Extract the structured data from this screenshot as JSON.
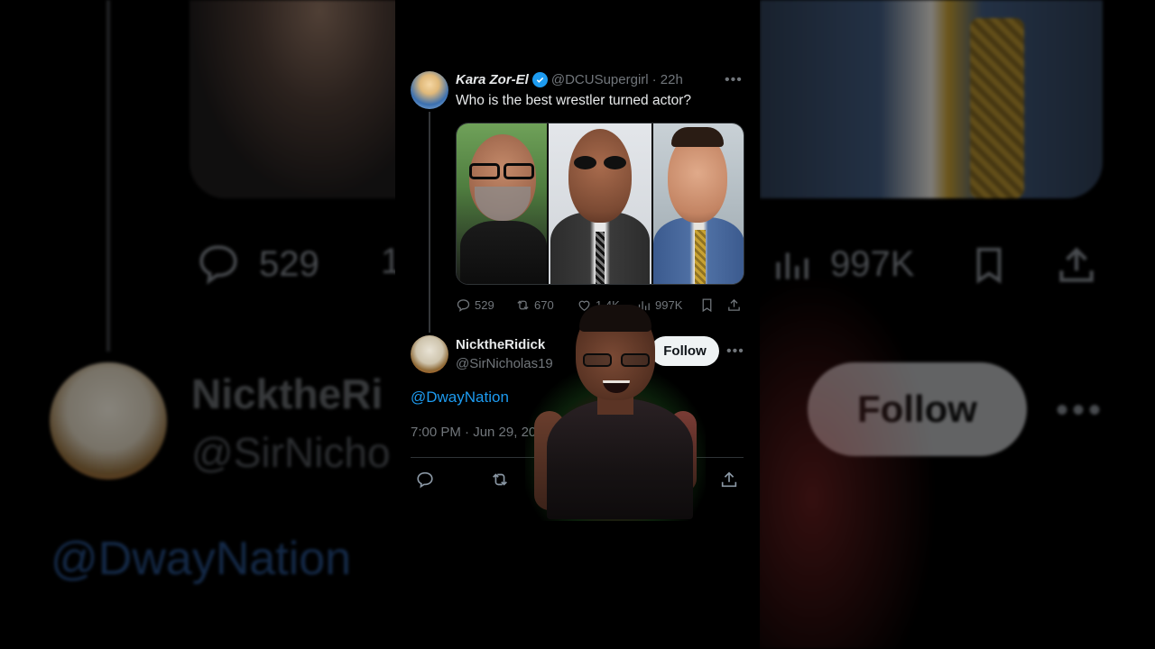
{
  "background": {
    "reply_count": "529",
    "views_count": "997K",
    "reply_name": "NicktheRi",
    "reply_handle": "@SirNicho",
    "mention": "@DwayNation",
    "follow_label": "Follow",
    "partial_repost": "1"
  },
  "tweet": {
    "author_name": "Kara Zor-El",
    "author_handle": "@DCUSupergirl",
    "time_ago": "· 22h",
    "text": "Who is the best wrestler turned actor?",
    "verified": true,
    "media_description_icons": [
      "photo-wrestler-1",
      "photo-wrestler-2",
      "photo-wrestler-3"
    ],
    "stats": {
      "replies": "529",
      "reposts": "670",
      "likes": "1.4K",
      "views": "997K"
    }
  },
  "reply": {
    "author_name": "NicktheRidick",
    "author_handle": "@SirNicholas19",
    "follow_label": "Follow",
    "mention": "@DwayNation",
    "timestamp": "7:00 PM · Jun 29, 20"
  },
  "colors": {
    "accent": "#1d9bf0",
    "muted": "#71767b",
    "text": "#e7e9ea",
    "background": "#000000"
  }
}
